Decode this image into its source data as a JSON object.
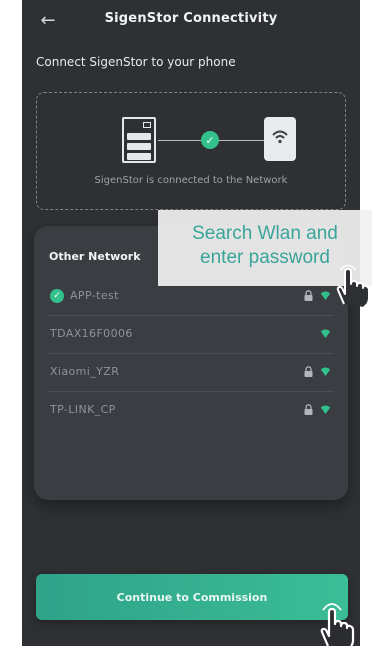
{
  "header": {
    "title": "SigenStor Connectivity",
    "back_icon": "arrow-left-icon"
  },
  "subtitle": "Connect SigenStor to your phone",
  "connection": {
    "status_text": "SigenStor is connected to the Network",
    "device_icon": "sigenstor-device-icon",
    "status_icon": "check-circle-icon",
    "router_icon": "wifi-router-icon"
  },
  "networks": {
    "header": "Other Network",
    "items": [
      {
        "name": "APP-test",
        "connected": true,
        "locked": true
      },
      {
        "name": "TDAX16F0006",
        "connected": false,
        "locked": false
      },
      {
        "name": "Xiaomi_YZR",
        "connected": false,
        "locked": true
      },
      {
        "name": "TP-LINK_CP",
        "connected": false,
        "locked": true
      }
    ]
  },
  "tooltip": {
    "line1": "Search Wlan and",
    "line2": "enter password"
  },
  "continue_button": "Continue to Commission",
  "colors": {
    "accent": "#32c08d",
    "background": "#2e3033",
    "panel": "#3a3d41",
    "tooltip_text": "#3aa59a"
  }
}
